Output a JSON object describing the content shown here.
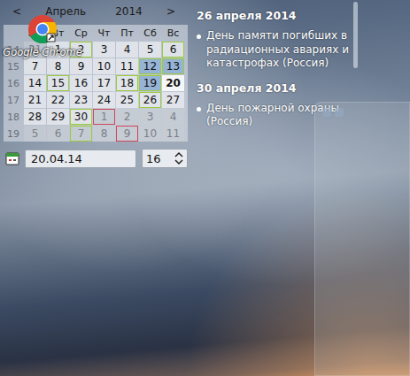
{
  "calendar": {
    "prev": "<",
    "month": "Апрель",
    "year": "2014",
    "next": ">",
    "weekdays": [
      "Пн",
      "Вт",
      "Ср",
      "Чт",
      "Пт",
      "Сб",
      "Вс"
    ],
    "weeks": [
      {
        "number": "14",
        "days": [
          {
            "day": "31",
            "other_month": true,
            "holiday": false,
            "selected": false,
            "color": null
          },
          {
            "day": "1",
            "other_month": false,
            "holiday": false,
            "selected": false,
            "color": null
          },
          {
            "day": "2",
            "other_month": false,
            "holiday": false,
            "selected": false,
            "color": "#9ccc3c"
          },
          {
            "day": "3",
            "other_month": false,
            "holiday": false,
            "selected": false,
            "color": null
          },
          {
            "day": "4",
            "other_month": false,
            "holiday": false,
            "selected": false,
            "color": null
          },
          {
            "day": "5",
            "other_month": false,
            "holiday": false,
            "selected": false,
            "color": null
          },
          {
            "day": "6",
            "other_month": false,
            "holiday": false,
            "selected": false,
            "color": "#9ccc3c"
          }
        ]
      },
      {
        "number": "15",
        "days": [
          {
            "day": "7",
            "other_month": false,
            "holiday": false,
            "selected": false,
            "color": null
          },
          {
            "day": "8",
            "other_month": false,
            "holiday": false,
            "selected": false,
            "color": null
          },
          {
            "day": "9",
            "other_month": false,
            "holiday": false,
            "selected": false,
            "color": null
          },
          {
            "day": "10",
            "other_month": false,
            "holiday": false,
            "selected": false,
            "color": null
          },
          {
            "day": "11",
            "other_month": false,
            "holiday": false,
            "selected": false,
            "color": null
          },
          {
            "day": "12",
            "other_month": false,
            "holiday": true,
            "selected": false,
            "color": "#9ccc3c"
          },
          {
            "day": "13",
            "other_month": false,
            "holiday": true,
            "selected": false,
            "color": "#9ccc3c"
          }
        ]
      },
      {
        "number": "16",
        "days": [
          {
            "day": "14",
            "other_month": false,
            "holiday": false,
            "selected": false,
            "color": null
          },
          {
            "day": "15",
            "other_month": false,
            "holiday": false,
            "selected": false,
            "color": "#9ccc3c"
          },
          {
            "day": "16",
            "other_month": false,
            "holiday": false,
            "selected": false,
            "color": null
          },
          {
            "day": "17",
            "other_month": false,
            "holiday": false,
            "selected": false,
            "color": null
          },
          {
            "day": "18",
            "other_month": false,
            "holiday": false,
            "selected": false,
            "color": "#9ccc3c"
          },
          {
            "day": "19",
            "other_month": false,
            "holiday": true,
            "selected": false,
            "color": "#9ccc3c"
          },
          {
            "day": "20",
            "other_month": false,
            "holiday": false,
            "selected": true,
            "color": null
          }
        ]
      },
      {
        "number": "17",
        "days": [
          {
            "day": "21",
            "other_month": false,
            "holiday": false,
            "selected": false,
            "color": null
          },
          {
            "day": "22",
            "other_month": false,
            "holiday": false,
            "selected": false,
            "color": null
          },
          {
            "day": "23",
            "other_month": false,
            "holiday": false,
            "selected": false,
            "color": null
          },
          {
            "day": "24",
            "other_month": false,
            "holiday": false,
            "selected": false,
            "color": null
          },
          {
            "day": "25",
            "other_month": false,
            "holiday": false,
            "selected": false,
            "color": null
          },
          {
            "day": "26",
            "other_month": false,
            "holiday": false,
            "selected": false,
            "color": "#9ccc3c"
          },
          {
            "day": "27",
            "other_month": false,
            "holiday": false,
            "selected": false,
            "color": null
          }
        ]
      },
      {
        "number": "18",
        "days": [
          {
            "day": "28",
            "other_month": false,
            "holiday": false,
            "selected": false,
            "color": null
          },
          {
            "day": "29",
            "other_month": false,
            "holiday": false,
            "selected": false,
            "color": null
          },
          {
            "day": "30",
            "other_month": false,
            "holiday": false,
            "selected": false,
            "color": "#9ccc3c"
          },
          {
            "day": "1",
            "other_month": true,
            "holiday": false,
            "selected": false,
            "color": "#d0455a"
          },
          {
            "day": "2",
            "other_month": true,
            "holiday": false,
            "selected": false,
            "color": null
          },
          {
            "day": "3",
            "other_month": true,
            "holiday": false,
            "selected": false,
            "color": null
          },
          {
            "day": "4",
            "other_month": true,
            "holiday": false,
            "selected": false,
            "color": null
          }
        ]
      },
      {
        "number": "19",
        "days": [
          {
            "day": "5",
            "other_month": true,
            "holiday": false,
            "selected": false,
            "color": null
          },
          {
            "day": "6",
            "other_month": true,
            "holiday": false,
            "selected": false,
            "color": null
          },
          {
            "day": "7",
            "other_month": true,
            "holiday": false,
            "selected": false,
            "color": "#9ccc3c"
          },
          {
            "day": "8",
            "other_month": true,
            "holiday": false,
            "selected": false,
            "color": null
          },
          {
            "day": "9",
            "other_month": true,
            "holiday": false,
            "selected": false,
            "color": "#d0455a"
          },
          {
            "day": "10",
            "other_month": true,
            "holiday": false,
            "selected": false,
            "color": null
          },
          {
            "day": "11",
            "other_month": true,
            "holiday": false,
            "selected": false,
            "color": null
          }
        ]
      }
    ],
    "date_field": "20.04.14",
    "hour_field": "16"
  },
  "events": {
    "scroll": {
      "level": 0.25
    },
    "groups": [
      {
        "date": "26 апреля 2014",
        "items": [
          "День памяти погибших в радиационных авариях и катастрофах (Россия)"
        ]
      },
      {
        "date": "30 апреля 2014",
        "items": [
          "День пожарной охраны (Россия)"
        ]
      }
    ]
  },
  "desktop_icons": [
    {
      "label": "Google Chrome"
    }
  ]
}
